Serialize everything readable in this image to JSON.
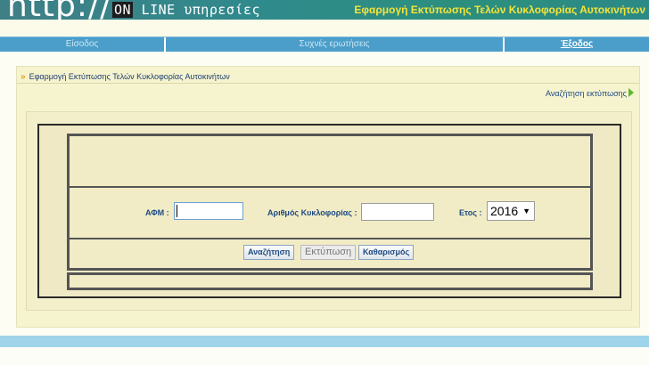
{
  "header": {
    "logo_http": "http://",
    "logo_on": "ON",
    "logo_rest": " LINE υπηρεσίες",
    "title": "Εφαρμογή Εκτύπωσης Τελών Κυκλοφορίας Αυτοκινήτων"
  },
  "nav": {
    "items": [
      {
        "label": "Είσοδος"
      },
      {
        "label": "Συχνές ερωτήσεις"
      },
      {
        "label": "Έξοδος"
      }
    ]
  },
  "breadcrumb": {
    "text": "Εφαρμογή Εκτύπωσης Τελών Κυκλοφορίας Αυτοκινήτων",
    "search_link": "Αναζήτηση εκτύπωσης"
  },
  "form": {
    "afm_label": "ΑΦΜ :",
    "afm_value": "",
    "plate_label": "Αριθμός Κυκλοφορίας :",
    "plate_value": "",
    "year_label": "Ετος :",
    "year_value": "2016",
    "search_button": "Αναζήτηση",
    "print_button": "Εκτύπωση",
    "clear_button": "Καθαρισμός"
  },
  "colors": {
    "header_title": "#f5e43a",
    "nav_bg": "#4b9ec9",
    "label_blue": "#1d4a82",
    "panel_bg": "#f6f3cf"
  }
}
